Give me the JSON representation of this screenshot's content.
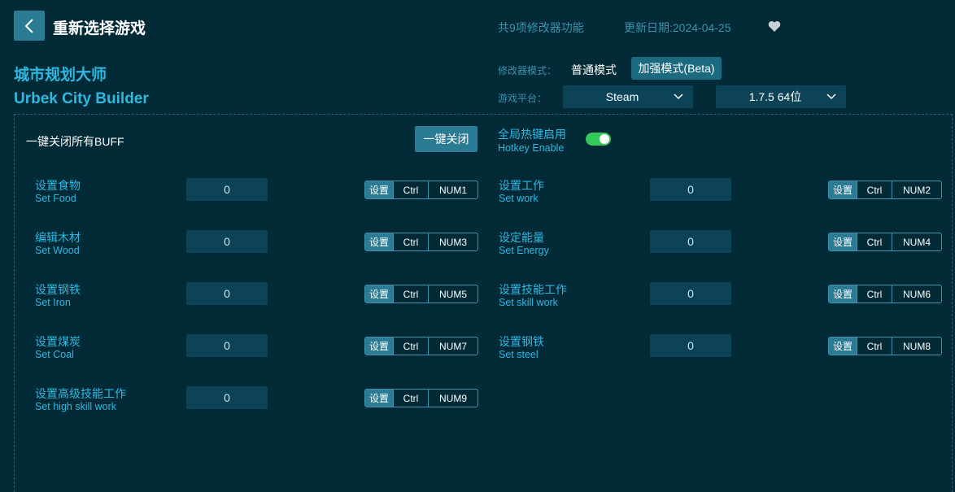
{
  "header": {
    "title": "重新选择游戏",
    "feature_count": "共9项修改器功能",
    "update_date": "更新日期:2024-04-25"
  },
  "game": {
    "name_cn": "城市规划大师",
    "name_en": "Urbek City Builder"
  },
  "mode": {
    "label": "修改器模式：",
    "normal": "普通模式",
    "beta": "加强模式(Beta)"
  },
  "platform": {
    "label": "游戏平台：",
    "platform_value": "Steam",
    "version_value": "1.7.5 64位"
  },
  "buff": {
    "label": "一键关闭所有BUFF",
    "close_button": "一键关闭"
  },
  "hotkey": {
    "label_cn": "全局热键启用",
    "label_en": "Hotkey Enable",
    "enabled": true
  },
  "cheats": [
    {
      "cn": "设置食物",
      "en": "Set Food",
      "value": "0",
      "set": "设置",
      "mod": "Ctrl",
      "key": "NUM1"
    },
    {
      "cn": "设置工作",
      "en": "Set work",
      "value": "0",
      "set": "设置",
      "mod": "Ctrl",
      "key": "NUM2"
    },
    {
      "cn": "编辑木材",
      "en": "Set Wood",
      "value": "0",
      "set": "设置",
      "mod": "Ctrl",
      "key": "NUM3"
    },
    {
      "cn": "设定能量",
      "en": "Set Energy",
      "value": "0",
      "set": "设置",
      "mod": "Ctrl",
      "key": "NUM4"
    },
    {
      "cn": "设置钢铁",
      "en": "Set Iron",
      "value": "0",
      "set": "设置",
      "mod": "Ctrl",
      "key": "NUM5"
    },
    {
      "cn": "设置技能工作",
      "en": "Set skill work",
      "value": "0",
      "set": "设置",
      "mod": "Ctrl",
      "key": "NUM6"
    },
    {
      "cn": "设置煤炭",
      "en": "Set Coal",
      "value": "0",
      "set": "设置",
      "mod": "Ctrl",
      "key": "NUM7"
    },
    {
      "cn": "设置钢铁",
      "en": "Set steel",
      "value": "0",
      "set": "设置",
      "mod": "Ctrl",
      "key": "NUM8"
    },
    {
      "cn": "设置高级技能工作",
      "en": "Set high skill work",
      "value": "0",
      "set": "设置",
      "mod": "Ctrl",
      "key": "NUM9"
    }
  ],
  "colors": {
    "background": "#022a37",
    "accent": "#2fb8e0",
    "button": "#2a7b93",
    "toggle_on": "#35c85a"
  }
}
